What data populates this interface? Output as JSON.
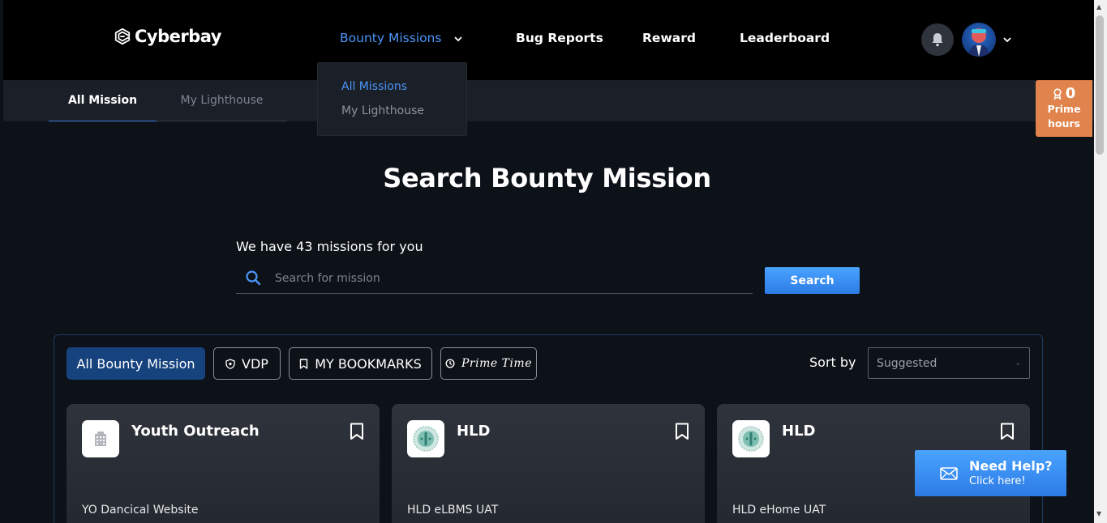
{
  "brand": {
    "name": "Cyberbay"
  },
  "nav": {
    "items": [
      {
        "label": "Bounty Missions",
        "active": true
      },
      {
        "label": "Bug Reports"
      },
      {
        "label": "Reward"
      },
      {
        "label": "Leaderboard"
      }
    ]
  },
  "dropdown": {
    "items": [
      {
        "label": "All Missions",
        "active": true
      },
      {
        "label": "My Lighthouse"
      }
    ]
  },
  "subtabs": [
    {
      "label": "All Mission",
      "active": true
    },
    {
      "label": "My Lighthouse"
    }
  ],
  "prime": {
    "count": "0",
    "label_line1": "Prime",
    "label_line2": "hours"
  },
  "hero": {
    "title": "Search Bounty Mission",
    "count_text": "We have 43 missions for you",
    "search_placeholder": "Search for mission",
    "search_button": "Search"
  },
  "filters": [
    {
      "label": "All Bounty Mission",
      "active": true
    },
    {
      "label": "VDP",
      "icon": "shield-icon"
    },
    {
      "label": "MY BOOKMARKS",
      "icon": "bookmark-icon"
    },
    {
      "label": "Prime Time",
      "icon": "clock-icon"
    }
  ],
  "sort": {
    "label": "Sort by",
    "value": "Suggested"
  },
  "cards": [
    {
      "title": "Youth Outreach",
      "subtitle": "YO Dancical Website",
      "logo": "building-icon"
    },
    {
      "title": "HLD",
      "subtitle": "HLD eLBMS UAT",
      "logo": "hld-seal"
    },
    {
      "title": "HLD",
      "subtitle": "HLD eHome UAT",
      "logo": "hld-seal"
    }
  ],
  "help": {
    "title": "Need Help?",
    "subtitle": "Click here!"
  },
  "colors": {
    "accent": "#4b95f7",
    "prime": "#e0834c",
    "button": "#2c7be5",
    "active_filter": "#16427d"
  }
}
